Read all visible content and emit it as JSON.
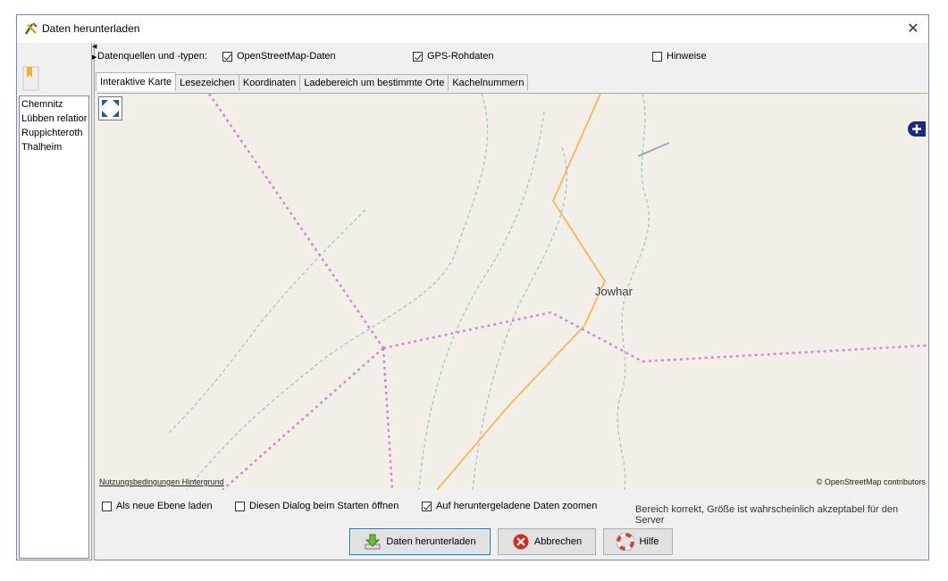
{
  "window": {
    "title": "Daten herunterladen"
  },
  "bookmarks": [
    "Chemnitz",
    "Lübben relation",
    "Ruppichteroth",
    "Thalheim"
  ],
  "sources": {
    "label": "Datenquellen und -typen:",
    "options": [
      {
        "label": "OpenStreetMap-Daten",
        "checked": true
      },
      {
        "label": "GPS-Rohdaten",
        "checked": true
      },
      {
        "label": "Hinweise",
        "checked": false
      }
    ]
  },
  "tabs": [
    {
      "label": "Interaktive Karte",
      "active": true
    },
    {
      "label": "Lesezeichen",
      "active": false
    },
    {
      "label": "Koordinaten",
      "active": false
    },
    {
      "label": "Ladebereich um bestimmte Orte",
      "active": false
    },
    {
      "label": "Kachelnummern",
      "active": false
    }
  ],
  "map": {
    "city": "Jowhar",
    "terms": "Nutzungsbedingungen Hintergrund",
    "attribution": "© OpenStreetMap contributors",
    "colors": {
      "land": "#f2efe9",
      "road": "#f8b55f",
      "boundary": "#cf89d2",
      "river": "#a9c9c9",
      "track": "#a3a3b8"
    }
  },
  "options": [
    {
      "label": "Als neue Ebene laden",
      "checked": false
    },
    {
      "label": "Diesen Dialog beim Starten öffnen",
      "checked": false
    },
    {
      "label": "Auf heruntergeladene Daten zoomen",
      "checked": true
    }
  ],
  "status": "Bereich korrekt, Größe ist wahrscheinlich akzeptabel für den Server",
  "buttons": {
    "download": "Daten herunterladen",
    "cancel": "Abbrechen",
    "help": "Hilfe"
  }
}
